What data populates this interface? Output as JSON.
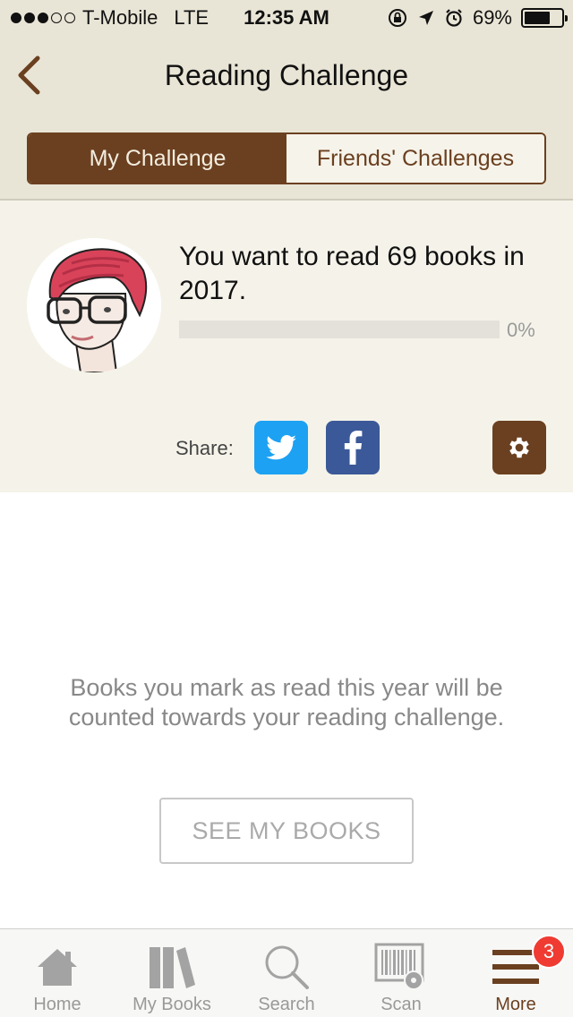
{
  "status_bar": {
    "carrier": "T-Mobile",
    "network": "LTE",
    "time": "12:35 AM",
    "battery": "69%",
    "battery_level": 0.69
  },
  "nav": {
    "title": "Reading Challenge",
    "back_icon": "chevron-left-icon"
  },
  "segments": {
    "my_challenge": "My Challenge",
    "friends_challenges": "Friends' Challenges",
    "active": "my_challenge"
  },
  "challenge": {
    "goal_text": "You want to read 69 books in 2017.",
    "progress_value": 0,
    "progress_label": "0%",
    "share_label": "Share:"
  },
  "empty_state": {
    "message": "Books you mark as read this year will be counted towards your reading challenge.",
    "button_label": "SEE MY BOOKS"
  },
  "tabs": [
    {
      "label": "Home",
      "icon": "home-icon"
    },
    {
      "label": "My Books",
      "icon": "books-icon"
    },
    {
      "label": "Search",
      "icon": "search-icon"
    },
    {
      "label": "Scan",
      "icon": "barcode-scan-icon"
    },
    {
      "label": "More",
      "icon": "menu-icon",
      "badge": "3"
    }
  ],
  "colors": {
    "brand_brown": "#6b4020",
    "header_beige": "#e9e5d6",
    "panel_cream": "#f5f3e9",
    "twitter_blue": "#1da1f2",
    "facebook_blue": "#3b5998",
    "badge_red": "#ef3b32"
  }
}
